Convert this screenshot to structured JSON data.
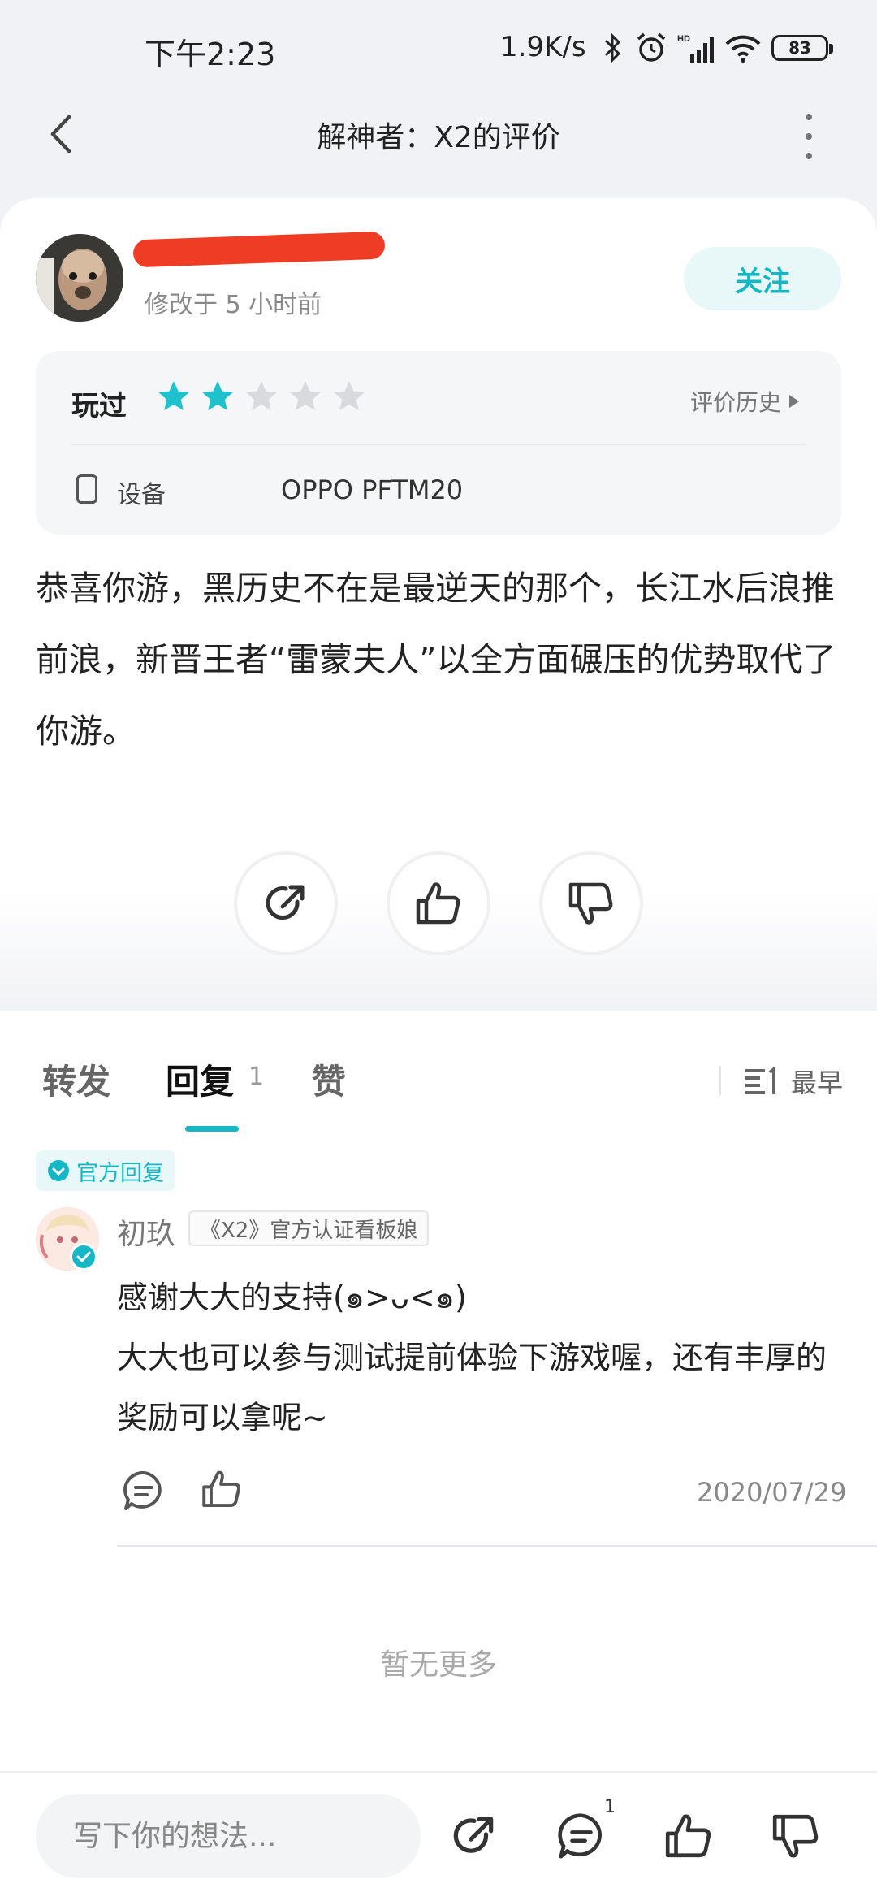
{
  "status_bar": {
    "time": "下午2:23",
    "network_speed": "1.9K/s",
    "battery": "83"
  },
  "header": {
    "title": "解神者：X2的评价"
  },
  "review": {
    "username": "",
    "edited": "修改于 5 小时前",
    "follow_label": "关注",
    "played_label": "玩过",
    "rating": 2,
    "rating_max": 5,
    "history_label": "评价历史",
    "device_label": "设备",
    "device_value": "OPPO PFTM20",
    "text": "恭喜你游，黑历史不在是最逆天的那个，长江水后浪推前浪，新晋王者“雷蒙夫人”以全方面碾压的优势取代了你游。"
  },
  "tabs": {
    "items": [
      {
        "label": "转发"
      },
      {
        "label": "回复"
      },
      {
        "label": "赞"
      }
    ],
    "reply_count": "1",
    "sort_label": "最早"
  },
  "reply": {
    "badge": "官方回复",
    "name": "初玖",
    "tag": "《X2》官方认证看板娘",
    "line1": "感谢大大的支持(๑>ᴗ<๑)",
    "line2": "大大也可以参与测试提前体验下游戏喔，还有丰厚的奖励可以拿呢~",
    "date": "2020/07/29"
  },
  "footer": {
    "no_more": "暂无更多"
  },
  "bottom_bar": {
    "placeholder": "写下你的想法...",
    "comment_count": "1"
  },
  "colors": {
    "accent": "#16b7c4",
    "star_filled": "#1fc1cc",
    "star_empty": "#d9dadd",
    "redaction": "#ee3d24"
  }
}
